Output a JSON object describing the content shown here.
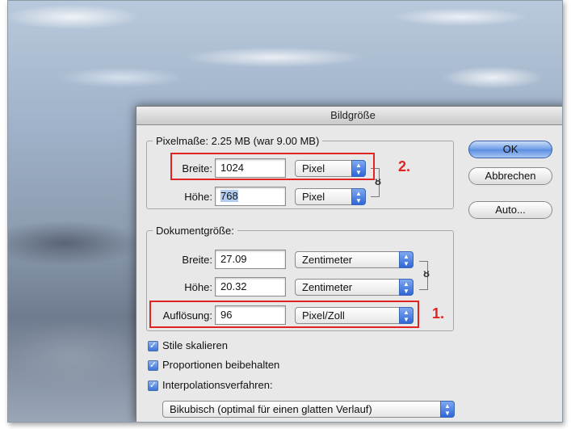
{
  "dialog": {
    "title": "Bildgröße",
    "pixel_group": {
      "legend": "Pixelmaße: 2.25 MB (war 9.00 MB)",
      "width_label": "Breite:",
      "width_value": "1024",
      "width_unit": "Pixel",
      "height_label": "Höhe:",
      "height_value": "768",
      "height_unit": "Pixel"
    },
    "doc_group": {
      "legend": "Dokumentgröße:",
      "width_label": "Breite:",
      "width_value": "27.09",
      "width_unit": "Zentimeter",
      "height_label": "Höhe:",
      "height_value": "20.32",
      "height_unit": "Zentimeter",
      "res_label": "Auflösung:",
      "res_value": "96",
      "res_unit": "Pixel/Zoll"
    },
    "buttons": {
      "ok": "OK",
      "cancel": "Abbrechen",
      "auto": "Auto..."
    },
    "checkboxes": [
      {
        "label": "Stile skalieren",
        "checked": true
      },
      {
        "label": "Proportionen beibehalten",
        "checked": true
      },
      {
        "label": "Interpolationsverfahren:",
        "checked": true
      }
    ],
    "interpolation": "Bikubisch (optimal für einen glatten Verlauf)"
  },
  "annotations": {
    "first": "1.",
    "second": "2."
  },
  "colors": {
    "annotation": "#e02424",
    "accent": "#3b73d8"
  },
  "icons": {
    "chain": "chain-link-icon",
    "checkmark": "checkmark-icon",
    "popup_arrows": "up-down-arrows-icon"
  }
}
